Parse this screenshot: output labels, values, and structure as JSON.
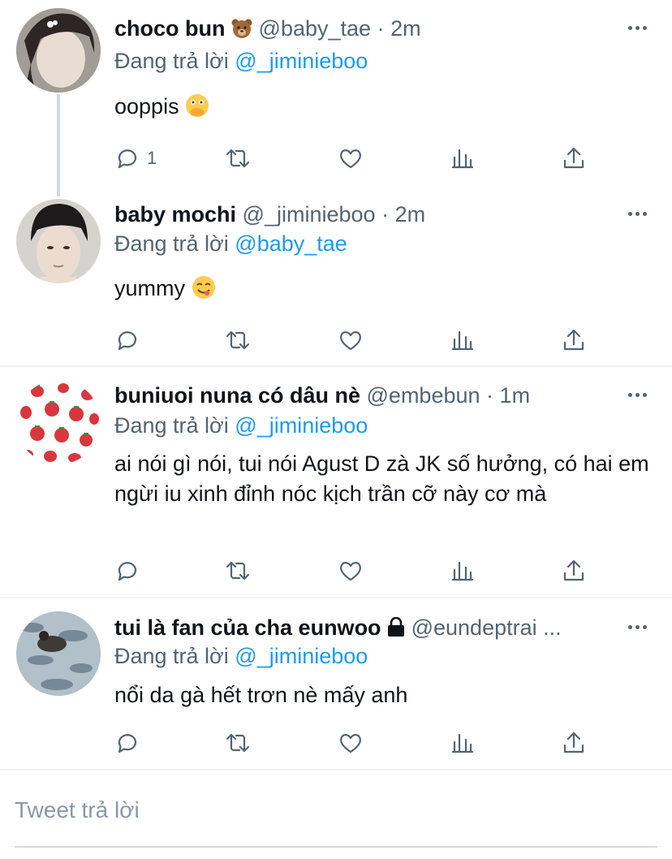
{
  "tweets": [
    {
      "name": "choco bun",
      "name_emoji": "bear-face-emoji",
      "handle": "@baby_tae",
      "time": "2m",
      "replying_prefix": "Đang trả lời",
      "replying_to": "@_jiminieboo",
      "text": "ooppis",
      "text_emoji": "face-with-open-eyes-and-hand-over-mouth-emoji",
      "reply_count": "1"
    },
    {
      "name": "baby mochi",
      "handle": "@_jiminieboo",
      "time": "2m",
      "replying_prefix": "Đang trả lời",
      "replying_to": "@baby_tae",
      "text": "yummy",
      "text_emoji": "face-savoring-food-emoji",
      "reply_count": ""
    },
    {
      "name": "buniuoi nuna có dâu nè",
      "handle": "@embebun",
      "time": "1m",
      "replying_prefix": "Đang trả lời",
      "replying_to": "@_jiminieboo",
      "text": "ai nói gì nói, tui nói Agust D zà JK số hưởng, có hai em ngừi iu xinh đỉnh nóc kịch trần cỡ này cơ mà",
      "reply_count": ""
    },
    {
      "name": "tui là fan của cha eunwoo",
      "name_icon": "lock-icon",
      "handle": "@eundeptrai ...",
      "time": "",
      "replying_prefix": "Đang trả lời",
      "replying_to": "@_jiminieboo",
      "text": "nổi da gà hết trơn nè mấy anh",
      "reply_count": ""
    }
  ],
  "time_separator": "·",
  "compose": {
    "placeholder": "Tweet trả lời"
  },
  "icons": [
    "reply-icon",
    "retweet-icon",
    "like-icon",
    "analytics-icon",
    "share-icon",
    "more-icon"
  ],
  "colors": {
    "link": "#1d9bf0",
    "muted": "#536471",
    "divider": "#eff3f4",
    "text": "#0f1419"
  }
}
